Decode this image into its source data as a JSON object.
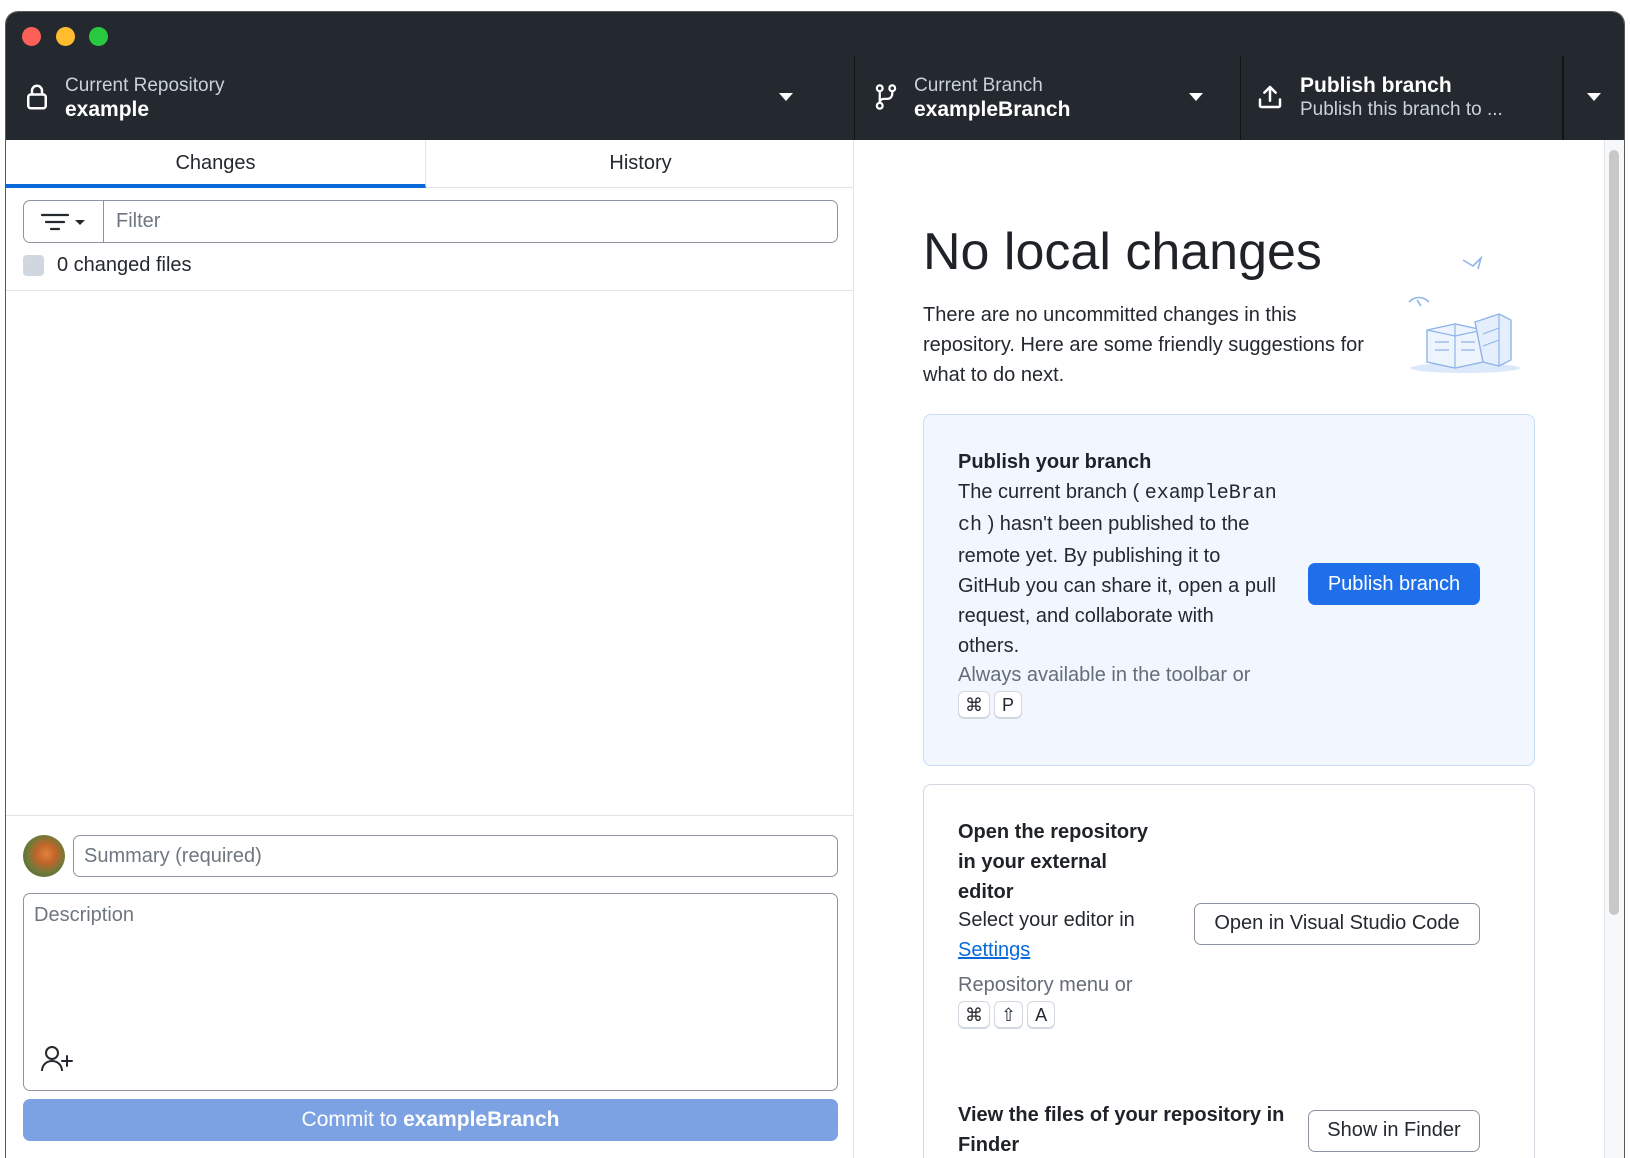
{
  "toolbar": {
    "repo": {
      "label": "Current Repository",
      "value": "example"
    },
    "branch": {
      "label": "Current Branch",
      "value": "exampleBranch"
    },
    "publish": {
      "label": "Publish branch",
      "sub": "Publish this branch to ..."
    }
  },
  "tabs": {
    "changes": "Changes",
    "history": "History"
  },
  "filter": {
    "placeholder": "Filter"
  },
  "changed_files": {
    "label": "0 changed files"
  },
  "commit": {
    "summary_placeholder": "Summary (required)",
    "description_placeholder": "Description",
    "button_prefix": "Commit to",
    "button_branch": "exampleBranch"
  },
  "main": {
    "headline": "No local changes",
    "intro": "There are no uncommitted changes in this repository. Here are some friendly suggestions for what to do next.",
    "publish_card": {
      "title": "Publish your branch",
      "body_pre": "The current branch (",
      "branch_mono": "exampleBranch",
      "body_post": ") hasn't been published to the remote yet. By publishing it to GitHub you can share it, open a pull request, and collaborate with others.",
      "hint": "Always available in the toolbar or",
      "keys": [
        "⌘",
        "P"
      ],
      "button": "Publish branch"
    },
    "editor_card": {
      "title": "Open the repository in your external editor",
      "body": "Select your editor in",
      "link": "Settings",
      "hint": "Repository menu or",
      "keys": [
        "⌘",
        "⇧",
        "A"
      ],
      "button": "Open in Visual Studio Code"
    },
    "finder_card": {
      "title": "View the files of your repository in Finder",
      "button": "Show in Finder"
    }
  },
  "colors": {
    "accent": "#0969da",
    "primary_button": "#1f6feb",
    "commit_button": "#7da2e3",
    "toolbar_bg": "#24292f"
  },
  "icons": [
    "lock-icon",
    "branch-icon",
    "upload-icon",
    "filter-icon",
    "add-coauthor-icon"
  ]
}
